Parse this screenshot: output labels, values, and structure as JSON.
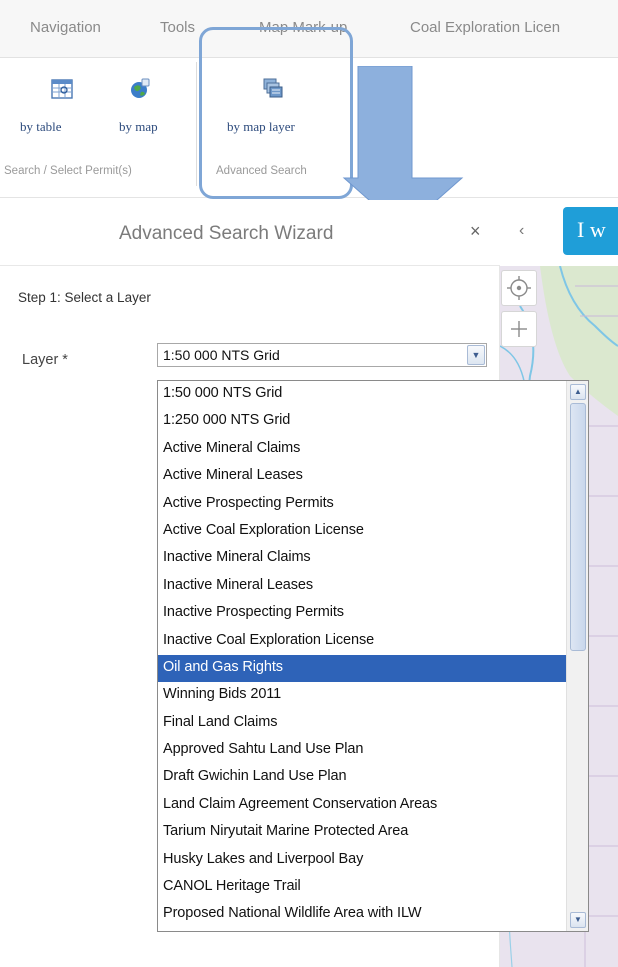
{
  "menubar": {
    "items": [
      "Navigation",
      "Tools",
      "Map Mark-up",
      "Coal Exploration Licen"
    ]
  },
  "ribbon": {
    "by_table": "by table",
    "by_map": "by map",
    "by_map_layer": "by map layer",
    "group_search_select": "Search / Select Permit(s)",
    "group_advanced": "Advanced Search",
    "icons": [
      "table-grid-icon",
      "globe-icon",
      "stacked-layers-icon"
    ]
  },
  "wizard": {
    "title": "Advanced Search Wizard",
    "close": "×",
    "step": "Step 1: Select a Layer",
    "layer_label": "Layer *",
    "layer_value": "1:50 000 NTS Grid",
    "selected_index": 10,
    "options": [
      "1:50 000 NTS Grid",
      "1:250 000 NTS Grid",
      "Active Mineral Claims",
      "Active Mineral Leases",
      "Active Prospecting Permits",
      "Active Coal Exploration License",
      "Inactive Mineral Claims",
      "Inactive Mineral Leases",
      "Inactive Prospecting Permits",
      "Inactive Coal Exploration License",
      "Oil and Gas Rights",
      "Winning Bids 2011",
      "Final Land Claims",
      "Approved Sahtu Land Use Plan",
      "Draft Gwichin Land Use Plan",
      "Land Claim Agreement Conservation Areas",
      "Tarium Niryutait Marine Protected Area",
      "Husky Lakes and Liverpool Bay",
      "CANOL Heritage Trail",
      "Proposed National Wildlife Area with ILW"
    ]
  },
  "panel": {
    "collapse": "‹",
    "tab_text": "I w"
  },
  "map": {
    "controls": [
      "locate-icon",
      "zoom-in-icon"
    ]
  },
  "colors": {
    "highlight": "#7fa6d6",
    "selected_row": "#2e63b8",
    "tab_blue": "#1f9ed8",
    "arrow": "#8db0dd"
  }
}
